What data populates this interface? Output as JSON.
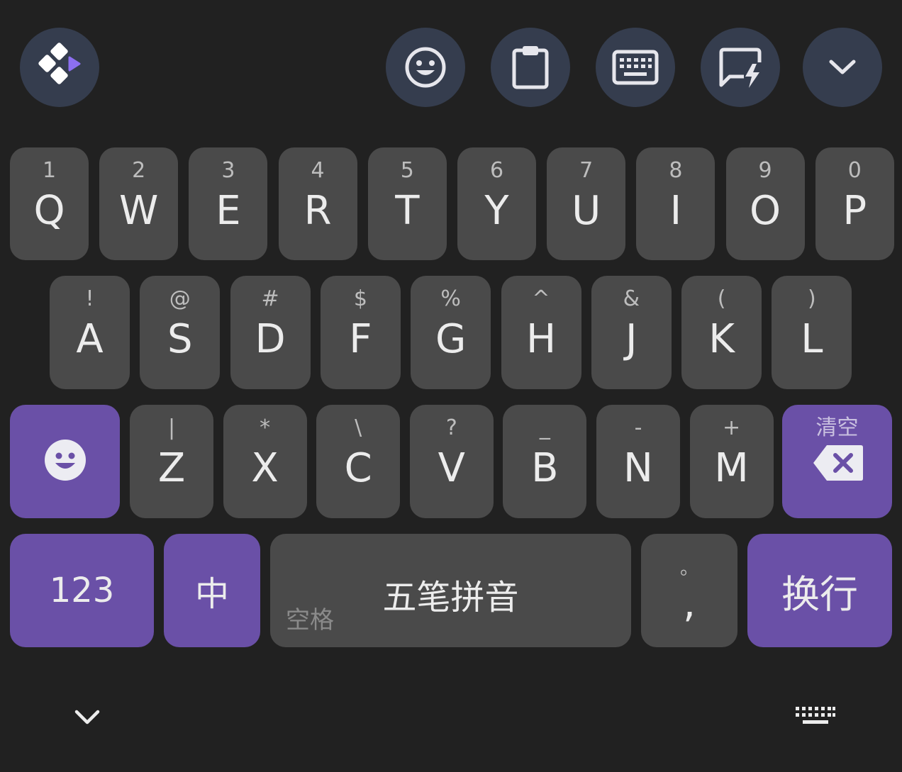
{
  "toolbar": {
    "items": [
      {
        "name": "app-menu-button",
        "icon": "app-logo-icon"
      },
      {
        "name": "emoji-button",
        "icon": "smiley-icon"
      },
      {
        "name": "clipboard-button",
        "icon": "clipboard-icon"
      },
      {
        "name": "keyboard-layout-button",
        "icon": "keyboard-icon"
      },
      {
        "name": "quick-phrase-button",
        "icon": "quick-phrase-icon"
      },
      {
        "name": "collapse-toolbar-button",
        "icon": "chevron-down-icon"
      }
    ]
  },
  "rows": {
    "row1": [
      {
        "hint": "1",
        "main": "Q"
      },
      {
        "hint": "2",
        "main": "W"
      },
      {
        "hint": "3",
        "main": "E"
      },
      {
        "hint": "4",
        "main": "R"
      },
      {
        "hint": "5",
        "main": "T"
      },
      {
        "hint": "6",
        "main": "Y"
      },
      {
        "hint": "7",
        "main": "U"
      },
      {
        "hint": "8",
        "main": "I"
      },
      {
        "hint": "9",
        "main": "O"
      },
      {
        "hint": "0",
        "main": "P"
      }
    ],
    "row2": [
      {
        "hint": "!",
        "main": "A"
      },
      {
        "hint": "@",
        "main": "S"
      },
      {
        "hint": "#",
        "main": "D"
      },
      {
        "hint": "$",
        "main": "F"
      },
      {
        "hint": "%",
        "main": "G"
      },
      {
        "hint": "^",
        "main": "H"
      },
      {
        "hint": "&",
        "main": "J"
      },
      {
        "hint": "(",
        "main": "K"
      },
      {
        "hint": ")",
        "main": "L"
      }
    ],
    "row3": [
      {
        "hint": "|",
        "main": "Z"
      },
      {
        "hint": "*",
        "main": "X"
      },
      {
        "hint": "\\",
        "main": "C"
      },
      {
        "hint": "?",
        "main": "V"
      },
      {
        "hint": "_",
        "main": "B"
      },
      {
        "hint": "-",
        "main": "N"
      },
      {
        "hint": "+",
        "main": "M"
      }
    ]
  },
  "keys": {
    "backspace_hint": "清空",
    "numbers_label": "123",
    "lang_label": "中",
    "space_label": "五笔拼音",
    "space_sub": "空格",
    "comma_hint": "。",
    "comma_main": ",",
    "enter_label": "换行"
  },
  "colors": {
    "background": "#212121",
    "key": "#4a4a4a",
    "accent": "#6a50a7",
    "toolbar_button": "#353d4e"
  }
}
